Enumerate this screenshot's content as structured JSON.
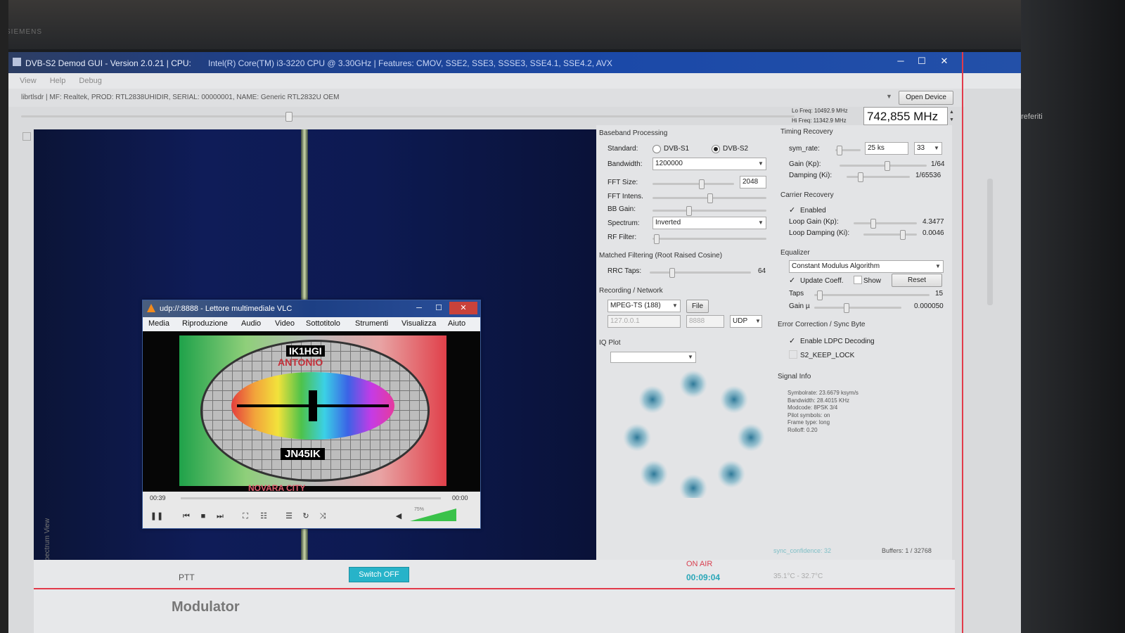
{
  "monitor": {
    "brand": "SIEMENS"
  },
  "window": {
    "title": "DVB-S2 Demod GUI - Version 2.0.21 | CPU:",
    "cpu": "Intel(R) Core(TM) i3-3220 CPU @ 3.30GHz | Features: CMOV, SSE2, SSE3, SSSE3, SSE4.1, SSE4.2, AVX",
    "minimize": "─",
    "maximize": "☐",
    "close": "✕"
  },
  "menubar": [
    "View",
    "Help",
    "Debug"
  ],
  "device": {
    "info": "librtlsdr | MF: Realtek, PROD: RTL2838UHIDIR, SERIAL: 00000001, NAME: Generic RTL2832U OEM",
    "open_label": "Open Device",
    "lo_freq": "Lo Freq: 10492.9 MHz",
    "hi_freq": "Hi Freq: 11342.9 MHz",
    "frequency": "742,855 MHz",
    "side_text": "preferiti"
  },
  "spectrum": {
    "label": "Spectrum View"
  },
  "baseband": {
    "title": "Baseband Processing",
    "standard_label": "Standard:",
    "standards": [
      "DVB-S1",
      "DVB-S2"
    ],
    "selected_standard": "DVB-S2",
    "bandwidth_label": "Bandwidth:",
    "bandwidth": "1200000",
    "fft_size_label": "FFT Size:",
    "fft_size": "2048",
    "fft_intens_label": "FFT Intens.",
    "bb_gain_label": "BB Gain:",
    "spectrum_label": "Spectrum:",
    "spectrum_value": "Inverted",
    "rf_filter_label": "RF Filter:"
  },
  "matched": {
    "title": "Matched Filtering (Root Raised Cosine)",
    "rrc_label": "RRC Taps:",
    "rrc_value": "64"
  },
  "recording": {
    "title": "Recording / Network",
    "format": "MPEG-TS (188)",
    "file_label": "File",
    "ip": "127.0.0.1",
    "port": "8888",
    "protocol": "UDP"
  },
  "iq": {
    "title": "IQ Plot"
  },
  "timing": {
    "title": "Timing Recovery",
    "sym_rate_label": "sym_rate:",
    "sym_rate": "25 ks",
    "sym_rate_sel": "33",
    "gain_label": "Gain (Kp):",
    "gain_value": "1/64",
    "damping_label": "Damping (Ki):",
    "damping_value": "1/65536"
  },
  "carrier": {
    "title": "Carrier Recovery",
    "enabled_label": "Enabled",
    "loop_gain_label": "Loop Gain (Kp):",
    "loop_gain": "4.3477",
    "loop_damping_label": "Loop Damping (Ki):",
    "loop_damping": "0.0046"
  },
  "equalizer": {
    "title": "Equalizer",
    "algorithm": "Constant Modulus Algorithm",
    "update_label": "Update Coeff.",
    "show_label": "Show",
    "reset_label": "Reset",
    "taps_label": "Taps",
    "taps_value": "15",
    "gain_label": "Gain µ",
    "gain_value": "0.000050"
  },
  "errcorr": {
    "title": "Error Correction / Sync Byte",
    "ldpc_label": "Enable LDPC Decoding",
    "keep_lock_label": "S2_KEEP_LOCK"
  },
  "signal": {
    "title": "Signal Info",
    "lines": [
      "Symbolrate: 23.6679 ksym/s",
      "Bandwidth: 28.4015 KHz",
      "Modcode: 8PSK 3/4",
      "Pilot symbols: on",
      "Frame type: long",
      "Rolloff: 0.20"
    ]
  },
  "status": {
    "sync_confidence": "sync_confidence: 32",
    "buffers": "Buffers: 1 / 32768",
    "ptt": "PTT",
    "switch_off": "Switch OFF",
    "on_air": "ON AIR",
    "timer": "00:09:04",
    "temps": "35.1°C - 32.7°C",
    "modulator": "Modulator"
  },
  "vlc": {
    "title": "udp://:8888 - Lettore multimediale VLC",
    "menu": [
      "Media",
      "Riproduzione",
      "Audio",
      "Video",
      "Sottotitolo",
      "Strumenti",
      "Visualizza",
      "Aiuto"
    ],
    "callsign": "IK1HGI",
    "name": "ANTONIO",
    "locator": "JN45IK",
    "city": "NOVARA CITY",
    "time_elapsed": "00:39",
    "time_total": "00:00",
    "volume": "75%"
  },
  "colors": {
    "accent_title": "#1b49a8",
    "spectrum_bg": "#0f1c58",
    "switch_btn": "#27b3c9",
    "timer": "#2aa7b8",
    "red_line": "#e23a4a"
  }
}
